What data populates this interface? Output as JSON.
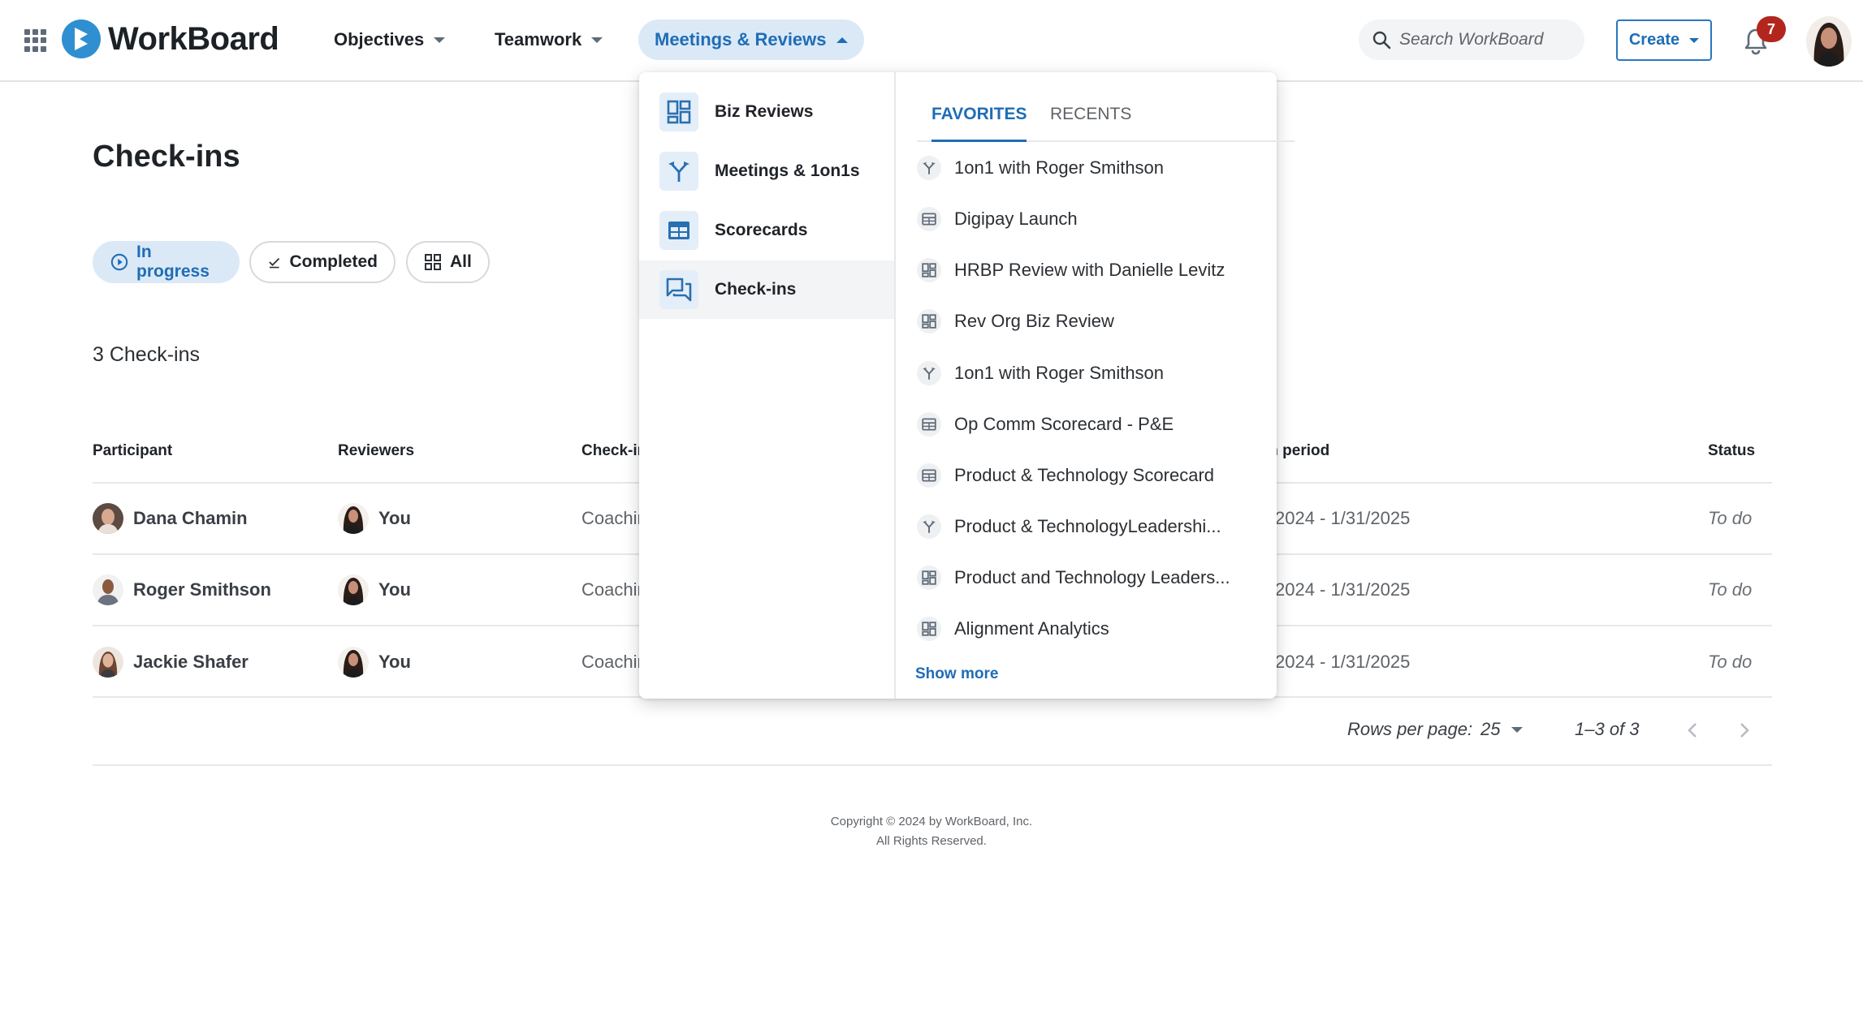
{
  "brand": {
    "name": "WorkBoard",
    "color": "#2f8fd0"
  },
  "nav": {
    "objectives": "Objectives",
    "teamwork": "Teamwork",
    "meetings_reviews": "Meetings & Reviews"
  },
  "search": {
    "placeholder": "Search WorkBoard"
  },
  "header": {
    "create_label": "Create",
    "notification_count": "7"
  },
  "page": {
    "title": "Check-ins",
    "filters": {
      "in_progress": "In progress",
      "completed": "Completed",
      "all": "All"
    },
    "count_text": "3 Check-ins"
  },
  "table": {
    "headers": {
      "participant": "Participant",
      "reviewers": "Reviewers",
      "checkin": "Check-in",
      "period": "in period",
      "status": "Status"
    },
    "rows": [
      {
        "participant": "Dana Chamin",
        "reviewer": "You",
        "checkin": "Coachin",
        "period": "2024 - 1/31/2025",
        "status": "To do"
      },
      {
        "participant": "Roger Smithson",
        "reviewer": "You",
        "checkin": "Coachin",
        "period": "2024 - 1/31/2025",
        "status": "To do"
      },
      {
        "participant": "Jackie Shafer",
        "reviewer": "You",
        "checkin": "Coachin",
        "period": "2024 - 1/31/2025",
        "status": "To do"
      }
    ]
  },
  "pagination": {
    "rows_per_page_label": "Rows per page:",
    "rows_per_page": "25",
    "range": "1–3 of 3"
  },
  "footer": {
    "line1": "Copyright © 2024 by WorkBoard, Inc.",
    "line2": "All Rights Reserved."
  },
  "dropdown": {
    "menu": [
      {
        "label": "Biz Reviews",
        "icon": "dashboard-icon"
      },
      {
        "label": "Meetings & 1on1s",
        "icon": "merge-icon"
      },
      {
        "label": "Scorecards",
        "icon": "table-icon"
      },
      {
        "label": "Check-ins",
        "icon": "chat-icon"
      }
    ],
    "tabs": {
      "favorites": "FAVORITES",
      "recents": "RECENTS"
    },
    "favorites": [
      {
        "label": "1on1 with Roger Smithson",
        "icon": "merge-icon"
      },
      {
        "label": "Digipay Launch",
        "icon": "table-icon"
      },
      {
        "label": "HRBP Review with Danielle Levitz",
        "icon": "dashboard-icon"
      },
      {
        "label": "Rev Org Biz Review",
        "icon": "dashboard-icon"
      },
      {
        "label": "1on1 with Roger Smithson",
        "icon": "merge-icon"
      },
      {
        "label": "Op Comm Scorecard - P&E",
        "icon": "table-icon"
      },
      {
        "label": "Product & Technology Scorecard",
        "icon": "table-icon"
      },
      {
        "label": "Product & TechnologyLeadershi...",
        "icon": "merge-icon"
      },
      {
        "label": "Product and Technology Leaders...",
        "icon": "dashboard-icon"
      },
      {
        "label": "Alignment Analytics",
        "icon": "dashboard-icon"
      }
    ],
    "show_more": "Show more"
  }
}
